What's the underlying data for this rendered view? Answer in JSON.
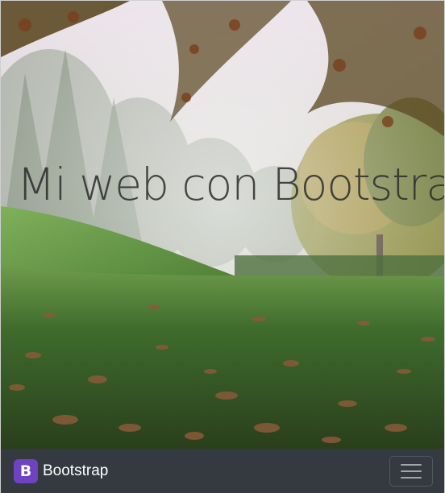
{
  "hero": {
    "title": "Mi web con Bootstrap"
  },
  "navbar": {
    "brand_logo_letter": "B",
    "brand_text": "Bootstrap",
    "toggler_icon": "hamburger-menu-icon"
  },
  "colors": {
    "navbar_bg": "#343a40",
    "brand_logo_bg": "#6f42c1",
    "title_color": "#2b2b2b"
  }
}
